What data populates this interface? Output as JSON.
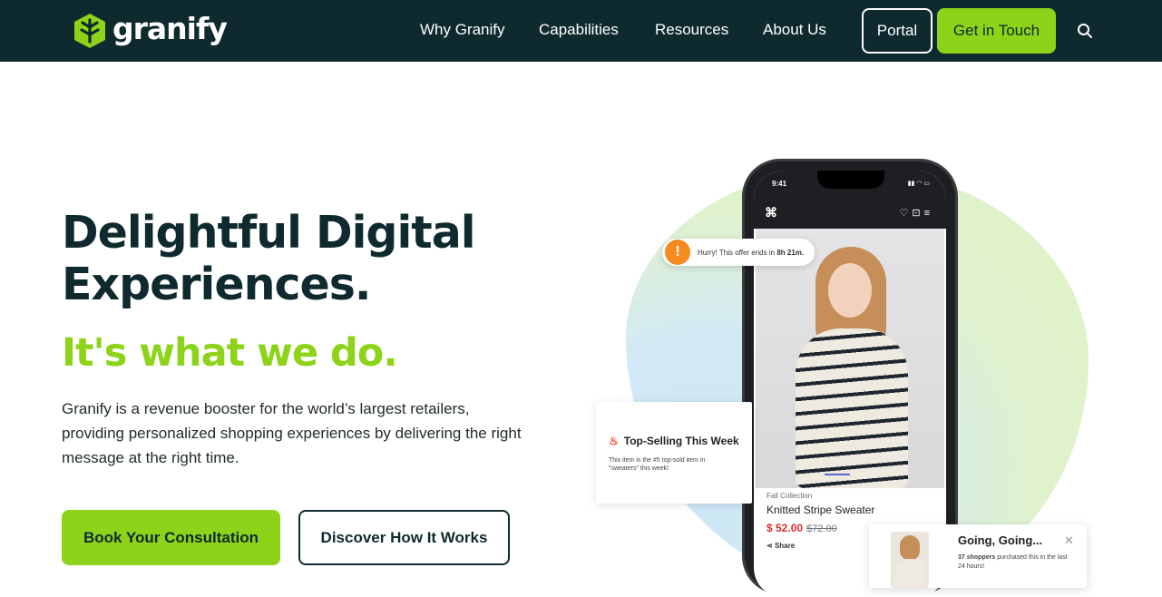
{
  "nav": {
    "logo_text": "granify",
    "links": [
      "Why Granify",
      "Capabilities",
      "Resources",
      "About Us"
    ],
    "portal_label": "Portal",
    "contact_label": "Get in Touch"
  },
  "colors": {
    "nav_bg": "#0f2a2e",
    "accent_green": "#8cd31a",
    "text_dark": "#0f2a2e"
  },
  "hero": {
    "title": "Delightful Digital Experiences.",
    "subtitle": "It's what we do.",
    "description": "Granify is a revenue booster for the world’s largest retailers, providing personalized shopping experiences by delivering the right message at the right time.",
    "primary_cta": "Book Your Consultation",
    "secondary_cta": "Discover How It Works"
  },
  "mockup": {
    "status_time": "9:41",
    "hurry_prefix": "Hurry! This offer ends in",
    "hurry_time": "8h 21m.",
    "top_selling_title": "Top-Selling This Week",
    "top_selling_desc": "This item is the #5 top-sold item in \"sweaters\" this week!",
    "product_collection": "Fall Collection",
    "product_name": "Knitted Stripe Sweater",
    "product_price": "$ 52.00",
    "product_old_price": "$72.00",
    "share_label": "Share",
    "going_title": "Going, Going...",
    "going_desc_count": "37 shoppers",
    "going_desc_rest": "purchased this in the last 24 hours!"
  }
}
